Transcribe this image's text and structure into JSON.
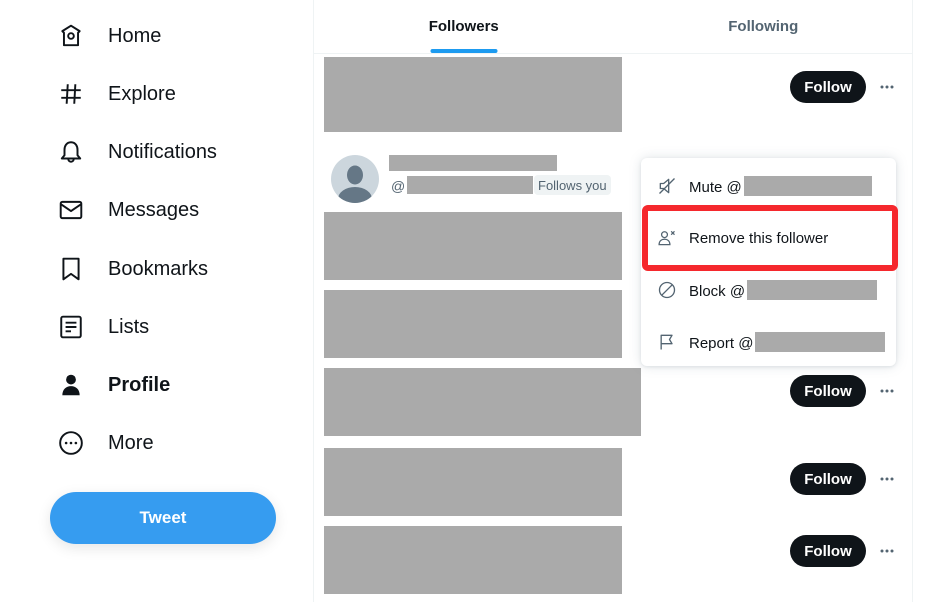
{
  "sidebar": {
    "items": [
      {
        "label": "Home",
        "icon": "home-icon",
        "active": false
      },
      {
        "label": "Explore",
        "icon": "hashtag-icon",
        "active": false
      },
      {
        "label": "Notifications",
        "icon": "bell-icon",
        "active": false
      },
      {
        "label": "Messages",
        "icon": "envelope-icon",
        "active": false
      },
      {
        "label": "Bookmarks",
        "icon": "bookmark-icon",
        "active": false
      },
      {
        "label": "Lists",
        "icon": "list-icon",
        "active": false
      },
      {
        "label": "Profile",
        "icon": "person-icon",
        "active": true
      },
      {
        "label": "More",
        "icon": "more-circle-icon",
        "active": false
      }
    ],
    "tweet_button": "Tweet"
  },
  "tabs": [
    {
      "label": "Followers",
      "active": true
    },
    {
      "label": "Following",
      "active": false
    }
  ],
  "followers": {
    "follow_label": "Follow",
    "at_prefix": "@",
    "follows_you_badge": "Follows you",
    "more_icon": "ellipsis-icon"
  },
  "menu": {
    "items": [
      {
        "label": "Mute @",
        "icon": "mute-icon"
      },
      {
        "label": "Remove this follower",
        "icon": "remove-follower-icon",
        "highlighted": true
      },
      {
        "label": "Block @",
        "icon": "block-icon"
      },
      {
        "label": "Report @",
        "icon": "flag-icon"
      }
    ]
  },
  "colors": {
    "accent": "#1d9bf0",
    "tweet_button": "#369cf0",
    "follow_button": "#0f1419",
    "highlight": "#f5282d",
    "redaction": "#aaaaaa"
  }
}
